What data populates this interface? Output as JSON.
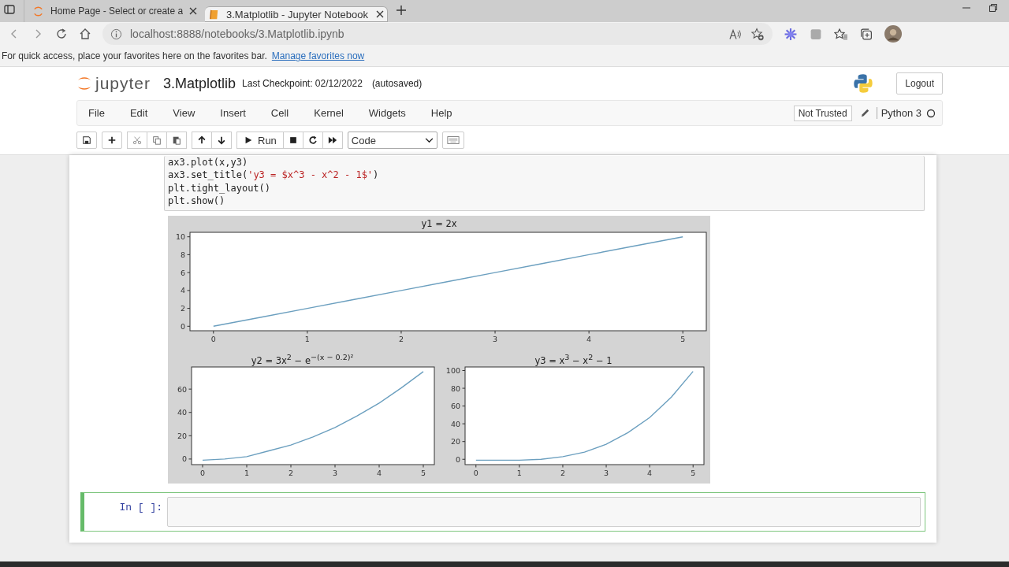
{
  "browser": {
    "tabs": [
      {
        "title": "Home Page - Select or create a",
        "selected": false
      },
      {
        "title": "3.Matplotlib - Jupyter Notebook",
        "selected": true
      }
    ],
    "address": "localhost:8888/notebooks/3.Matplotlib.ipynb",
    "favorites_bar": {
      "message": "For quick access, place your favorites here on the favorites bar.",
      "link": "Manage favorites now"
    }
  },
  "header": {
    "logo": "jupyter",
    "notebook_name": "3.Matplotlib",
    "checkpoint": "Last Checkpoint: 02/12/2022",
    "autosave": "(autosaved)",
    "logout": "Logout"
  },
  "menu": [
    "File",
    "Edit",
    "View",
    "Insert",
    "Cell",
    "Kernel",
    "Widgets",
    "Help"
  ],
  "kernel": {
    "trust": "Not Trusted",
    "name": "Python 3"
  },
  "toolbar": {
    "run": "Run",
    "cell_type": "Code"
  },
  "cells": [
    {
      "kind": "code",
      "lines": [
        [
          {
            "kind": "plain",
            "text": "ax3.plot(x,y3)"
          }
        ],
        [
          {
            "kind": "plain",
            "text": "ax3.set_title("
          },
          {
            "kind": "string",
            "text": "'y3 = $x^3 - x^2 - 1$'"
          },
          {
            "kind": "plain",
            "text": ")"
          }
        ],
        [
          {
            "kind": "plain",
            "text": "plt.tight_layout()"
          }
        ],
        [
          {
            "kind": "plain",
            "text": "plt.show()"
          }
        ]
      ],
      "output": {
        "charts": [
          {
            "chart_data": {
              "type": "line",
              "title": "y1 = 2x",
              "x": [
                0,
                0.5,
                1,
                1.5,
                2,
                2.5,
                3,
                3.5,
                4,
                4.5,
                5
              ],
              "series": [
                {
                  "color": "#6b9fbf",
                  "values": [
                    0,
                    1,
                    2,
                    3,
                    4,
                    5,
                    6,
                    7,
                    8,
                    9,
                    10
                  ]
                }
              ],
              "xlim": [
                -0.25,
                5.25
              ],
              "ylim": [
                -0.5,
                10.5
              ],
              "xticks": [
                0,
                1,
                2,
                3,
                4,
                5
              ],
              "yticks": [
                0,
                2,
                4,
                6,
                8,
                10
              ]
            }
          },
          {
            "chart_data": {
              "type": "line",
              "title": "y2 = 3x$^{2}$ − e$^{−(x − 0.2)²}$",
              "x": [
                0,
                0.5,
                1,
                1.5,
                2,
                2.5,
                3,
                3.5,
                4,
                4.5,
                5
              ],
              "series": [
                {
                  "color": "#6b9fbf",
                  "values": [
                    -1,
                    0,
                    2,
                    7,
                    12,
                    19,
                    27,
                    37,
                    48,
                    61,
                    75
                  ]
                }
              ],
              "xlim": [
                -0.25,
                5.25
              ],
              "ylim": [
                -4.8,
                79
              ],
              "xticks": [
                0,
                1,
                2,
                3,
                4,
                5
              ],
              "yticks": [
                0,
                20,
                40,
                60
              ]
            }
          },
          {
            "chart_data": {
              "type": "line",
              "title": "y3 = x$^{3}$ − x$^{2}$ − 1",
              "x": [
                0,
                0.5,
                1,
                1.5,
                2,
                2.5,
                3,
                3.5,
                4,
                4.5,
                5
              ],
              "series": [
                {
                  "color": "#6b9fbf",
                  "values": [
                    -1,
                    -1,
                    -1,
                    0,
                    3,
                    8,
                    17,
                    30,
                    47,
                    70,
                    99
                  ]
                }
              ],
              "xlim": [
                -0.25,
                5.25
              ],
              "ylim": [
                -6,
                104
              ],
              "xticks": [
                0,
                1,
                2,
                3,
                4,
                5
              ],
              "yticks": [
                0,
                20,
                40,
                60,
                80,
                100
              ]
            }
          }
        ]
      }
    },
    {
      "kind": "code",
      "prompt": "In [ ]:",
      "selected": true
    }
  ]
}
